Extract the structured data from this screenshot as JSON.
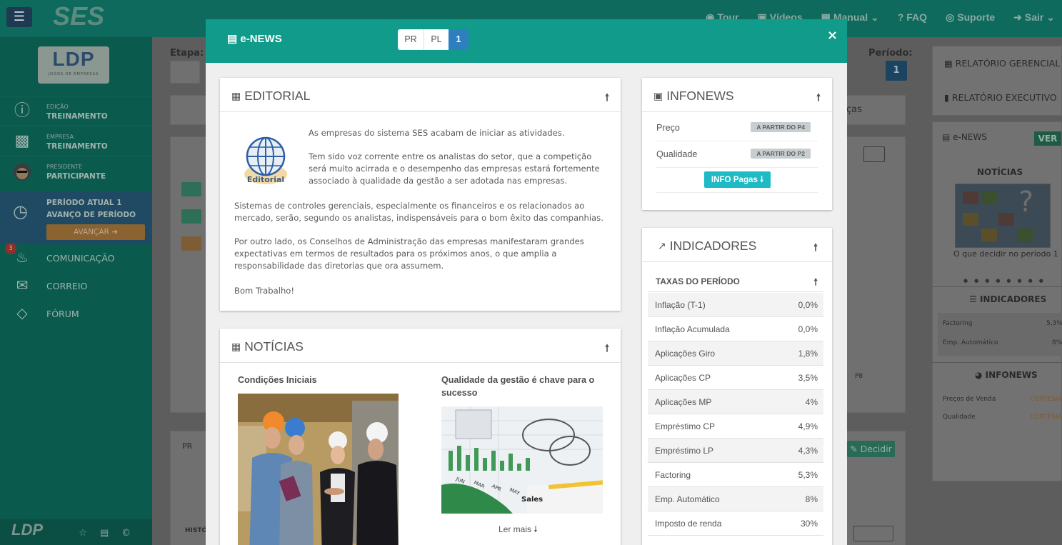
{
  "app": {
    "brand": "SES",
    "menu_icon": "hamburger-icon",
    "nav": [
      {
        "icon": "target-icon",
        "label": "Tour"
      },
      {
        "icon": "video-icon",
        "label": "Vídeos"
      },
      {
        "icon": "book-icon",
        "label": "Manual"
      },
      {
        "icon": "question-icon",
        "label": "FAQ"
      },
      {
        "icon": "lifebuoy-icon",
        "label": "Suporte"
      },
      {
        "icon": "exit-icon",
        "label": "Sair"
      }
    ]
  },
  "sidebar": {
    "logo_text": "LDP",
    "logo_sub": "JOGOS DE EMPRESAS",
    "edition_label": "EDIÇÃO",
    "edition_value": "TREINAMENTO",
    "company_label": "EMPRESA",
    "company_value": "TREINAMENTO",
    "president_label": "PRESIDENTE",
    "president_value": "PARTICIPANTE",
    "period_current": "PERÍODO ATUAL 1",
    "period_advance": "AVANÇO DE PERÍODO",
    "advance_button": "AVANÇAR",
    "notifications_count": "3",
    "links": [
      "COMUNICAÇÃO",
      "CORREIO",
      "FÓRUM"
    ],
    "footer_logo": "LDP"
  },
  "background": {
    "etapa_label": "Etapa:",
    "periodo_label": "Período:",
    "periodo_value": "1",
    "tab_fragment": "ças",
    "section_fragment": "PR",
    "history_fragment": "HISTÓ",
    "p8_label": "P8",
    "decide_button": "Decidir",
    "right": {
      "report_manager": "RELATÓRIO GERENCIAL",
      "report_exec": "RELATÓRIO EXECUTIVO",
      "enews_label": "e-NEWS",
      "ver_button": "VER",
      "noticias_head": "NOTÍCIAS",
      "news_caption": "O que decidir no período 1",
      "indicadores_head": "INDICADORES",
      "ind_rows": [
        {
          "k": "Factoring",
          "v": "5,3%"
        },
        {
          "k": "Emp. Automático",
          "v": "8%"
        }
      ],
      "infonews_head": "INFONEWS",
      "info_rows": [
        {
          "k": "Preços de Venda",
          "v": "CORTESIA"
        },
        {
          "k": "Qualidade",
          "v": "CORTESIA"
        }
      ]
    }
  },
  "modal": {
    "title": "e-NEWS",
    "segments": [
      "PR",
      "PL",
      "1"
    ],
    "close": "×",
    "editorial": {
      "title": "EDITORIAL",
      "logo_caption": "Editorial",
      "p1": "As empresas do sistema SES acabam de iniciar as atividades.",
      "p2": "Tem sido voz corrente entre os analistas do setor, que a competição será muito acirrada e o desempenho das empresas estará fortemente associado à qualidade da gestão a ser adotada nas empresas.",
      "p3": "Sistemas de controles gerenciais, especialmente os financeiros e os relacionados ao mercado, serão, segundo os analistas, indispensáveis para o bom êxito das companhias.",
      "p4": "Por outro lado, os Conselhos de Administração das empresas manifestaram grandes expectativas em termos de resultados para os próximos anos, o que amplia a responsabilidade das diretorias que ora assumem.",
      "p5": "Bom Trabalho!"
    },
    "noticias": {
      "title": "NOTÍCIAS",
      "items": [
        {
          "title": "Condições Iniciais"
        },
        {
          "title": "Qualidade da gestão é chave para o sucesso",
          "read_more": "Ler mais"
        }
      ],
      "chart_words": [
        "JUN",
        "MAR",
        "APR",
        "MAY",
        "Sales"
      ]
    },
    "infonews": {
      "title": "INFONEWS",
      "rows": [
        {
          "label": "Preço",
          "tag": "A PARTIR DO P4"
        },
        {
          "label": "Qualidade",
          "tag": "A PARTIR DO P2"
        }
      ],
      "button": "INFO Pagas"
    },
    "indicadores": {
      "title": "INDICADORES",
      "subheader": "TAXAS DO PERÍODO",
      "rows": [
        {
          "k": "Inflação (T-1)",
          "v": "0,0%"
        },
        {
          "k": "Inflação Acumulada",
          "v": "0,0%"
        },
        {
          "k": "Aplicações Giro",
          "v": "1,8%"
        },
        {
          "k": "Aplicações CP",
          "v": "3,5%"
        },
        {
          "k": "Aplicações MP",
          "v": "4%"
        },
        {
          "k": "Empréstimo CP",
          "v": "4,9%"
        },
        {
          "k": "Empréstimo LP",
          "v": "4,3%"
        },
        {
          "k": "Factoring",
          "v": "5,3%"
        },
        {
          "k": "Emp. Automático",
          "v": "8%"
        },
        {
          "k": "Imposto de renda",
          "v": "30%"
        }
      ]
    }
  }
}
